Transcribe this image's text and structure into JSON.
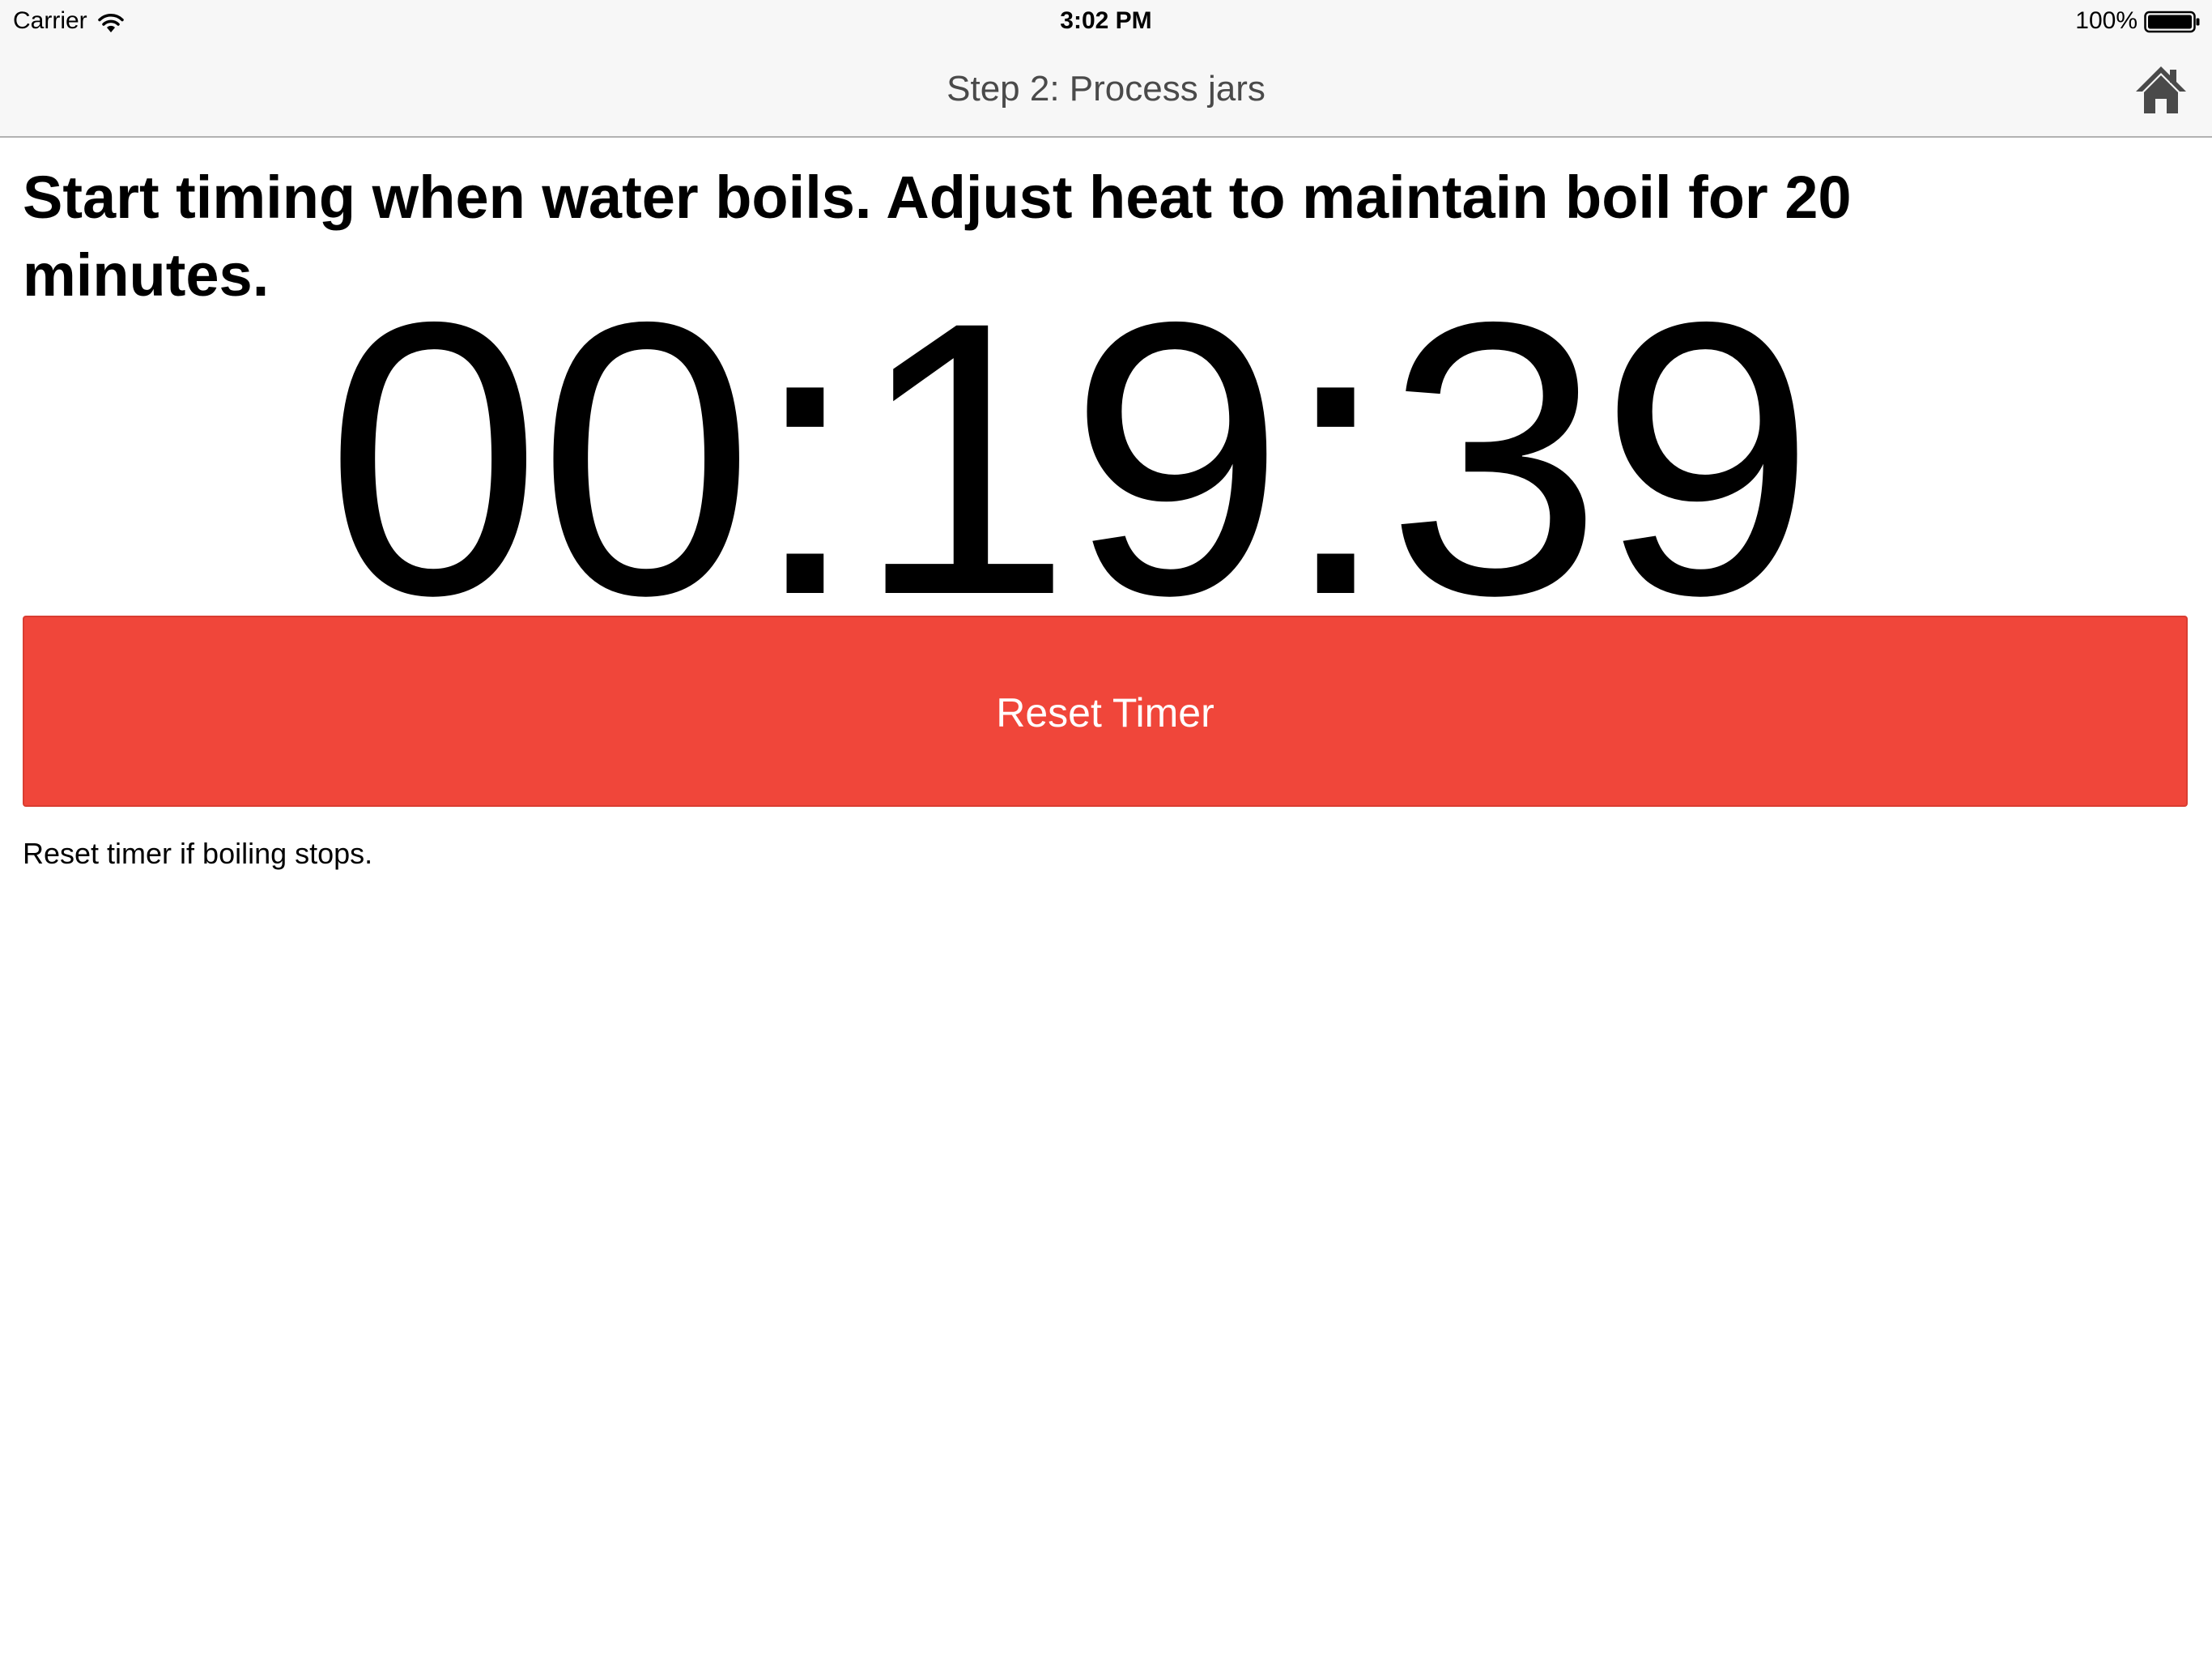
{
  "status_bar": {
    "carrier": "Carrier",
    "time": "3:02 PM",
    "battery": "100%",
    "icons": [
      "wifi-icon",
      "battery-icon"
    ]
  },
  "nav": {
    "title": "Step 2: Process jars",
    "home_icon": "home-icon"
  },
  "content": {
    "instruction": "Start timing when water boils. Adjust heat to maintain boil for 20 minutes.",
    "timer": "00:19:39",
    "reset_button_label": "Reset Timer",
    "hint": "Reset timer if boiling stops."
  },
  "colors": {
    "reset_button": "#f0463a",
    "nav_background": "#f7f7f7",
    "nav_title": "#4a4a4a"
  }
}
